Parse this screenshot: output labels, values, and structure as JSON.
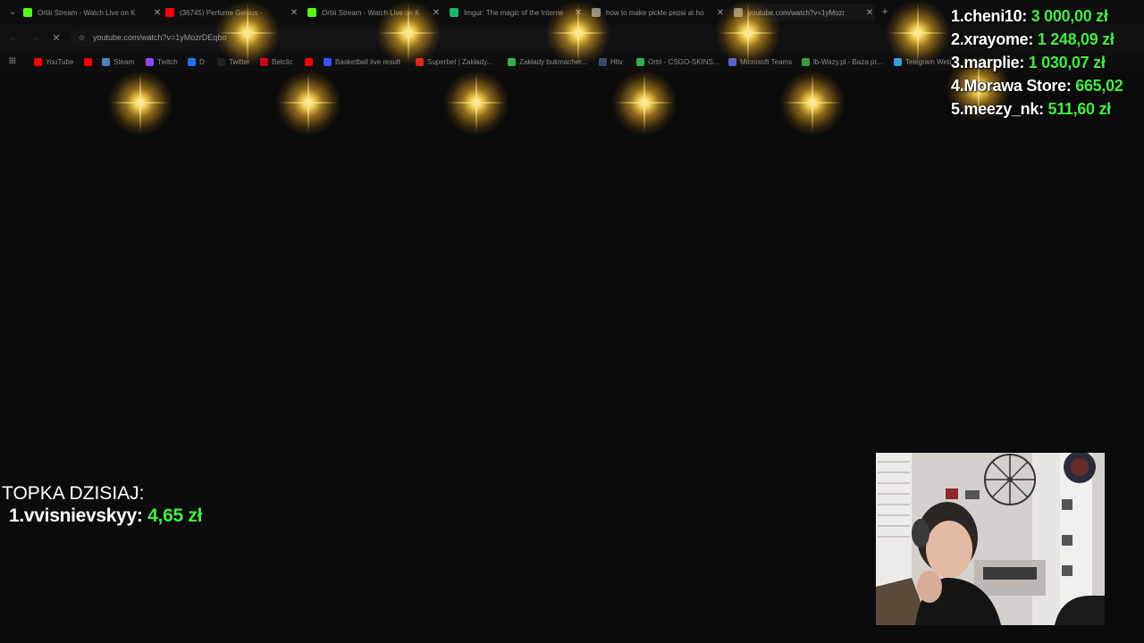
{
  "browser": {
    "tabs": [
      {
        "label": "Ortiii Stream - Watch Live on K",
        "icon": "kick-icon",
        "color": "#53fc18"
      },
      {
        "label": "(36745) Perfume Genius -",
        "icon": "youtube-icon",
        "color": "#ff0000"
      },
      {
        "label": "Ortiii Stream - Watch Live on K",
        "icon": "kick-icon",
        "color": "#53fc18"
      },
      {
        "label": "Imgur: The magic of the Interne",
        "icon": "imgur-icon",
        "color": "#1bb76e"
      },
      {
        "label": "how to make pickle pepsi at ho",
        "icon": "search-icon",
        "color": "#8a8a8a"
      },
      {
        "label": "youtube.com/watch?v=1yMozr",
        "icon": "globe-icon",
        "color": "#8a8a8a"
      }
    ],
    "url": "youtube.com/watch?v=1yMozrDEqbo",
    "bookmarks": [
      {
        "label": "YouTube",
        "icon": "youtube-icon",
        "color": "#ff0000"
      },
      {
        "label": "",
        "icon": "youtube-icon",
        "color": "#ff0000"
      },
      {
        "label": "Steam",
        "icon": "steam-icon",
        "color": "#4b7fbf"
      },
      {
        "label": "Twitch",
        "icon": "twitch-icon",
        "color": "#9146ff"
      },
      {
        "label": "D",
        "icon": "facebook-icon",
        "color": "#1877f2"
      },
      {
        "label": "Twitter",
        "icon": "twitter-icon",
        "color": "#222222"
      },
      {
        "label": "Betclic",
        "icon": "betclic-icon",
        "color": "#d0021b"
      },
      {
        "label": "",
        "icon": "youtube-icon",
        "color": "#ff0000"
      },
      {
        "label": "Basketball live result",
        "icon": "flashscore-icon",
        "color": "#3355ff"
      },
      {
        "label": "Superbet | Zakłady...",
        "icon": "superbet-icon",
        "color": "#e2231a"
      },
      {
        "label": "Zakłady bukmacher...",
        "icon": "fortuna-icon",
        "color": "#2bb24c"
      },
      {
        "label": "Hltv",
        "icon": "hltv-icon",
        "color": "#3b4a6b"
      },
      {
        "label": "Ortri - CSGO-SKINS...",
        "icon": "csgo-icon",
        "color": "#2bb24c"
      },
      {
        "label": "Microsoft Teams",
        "icon": "teams-icon",
        "color": "#5b5fc7"
      },
      {
        "label": "lb-Wazy.pl - Baza pr...",
        "icon": "database-icon",
        "color": "#3a9d3a"
      },
      {
        "label": "Telegram Web",
        "icon": "telegram-icon",
        "color": "#2aa1da"
      }
    ]
  },
  "overlay": {
    "leaderboard": [
      {
        "rank": "1.",
        "name": "cheni10:",
        "amount": "3 000,00 zł"
      },
      {
        "rank": "2.",
        "name": "xrayome:",
        "amount": "1 248,09 zł"
      },
      {
        "rank": "3.",
        "name": "marplie:",
        "amount": "1 030,07 zł"
      },
      {
        "rank": "4.",
        "name": "Morawa Store:",
        "amount": "665,02"
      },
      {
        "rank": "5.",
        "name": "meezy_nk:",
        "amount": "511,60 zł"
      }
    ],
    "topka": {
      "title": "TOPKA DZISIAJ:",
      "rank": "1.",
      "name": "vvisnievskyy:",
      "amount": "4,65 zł"
    },
    "accent_color": "#3ef03a"
  }
}
